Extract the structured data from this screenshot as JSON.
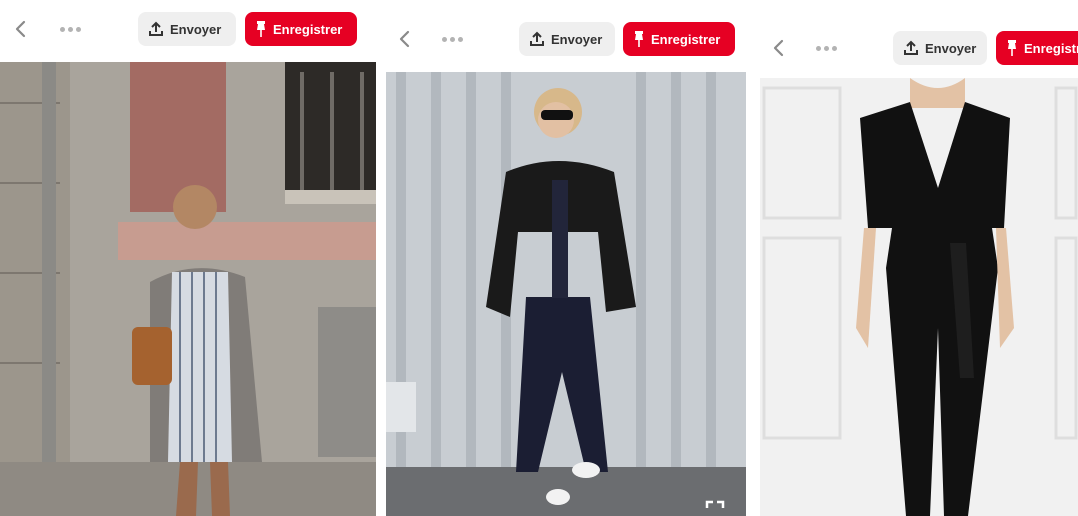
{
  "panels": [
    {
      "send_label": "Envoyer",
      "save_label": "Enregistrer"
    },
    {
      "send_label": "Envoyer",
      "save_label": "Enregistrer"
    },
    {
      "send_label": "Envoyer",
      "save_label": "Enregistrer"
    }
  ],
  "icons": {
    "back": "chevron-left-icon",
    "more": "more-dots-icon",
    "send": "upload-icon",
    "save": "pin-icon",
    "expand": "expand-icon"
  },
  "colors": {
    "save_button": "#e60023",
    "send_button": "#efefef"
  }
}
